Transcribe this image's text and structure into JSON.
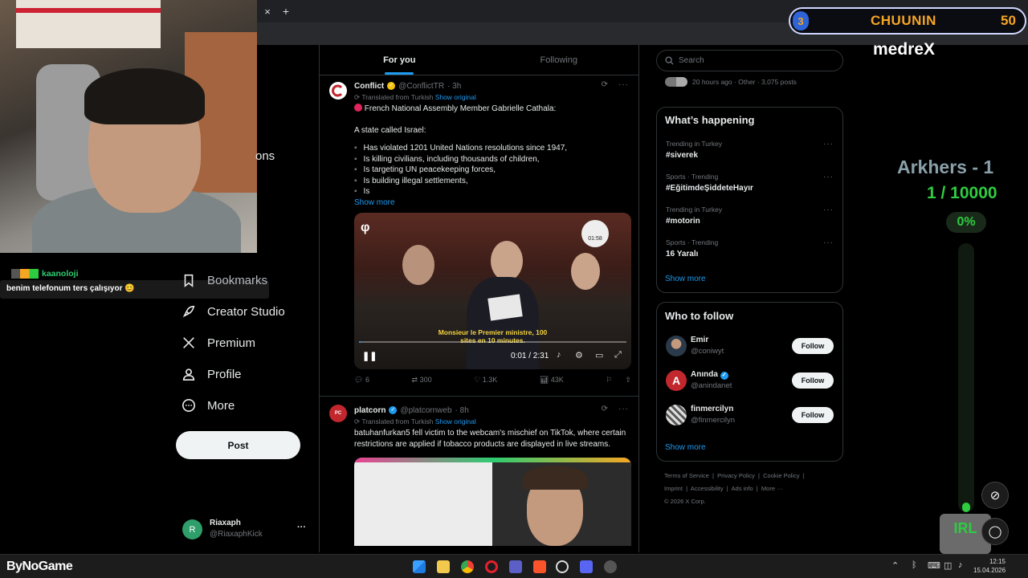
{
  "browser": {
    "close_tab": "×",
    "new_tab": "+"
  },
  "chat": {
    "username": "kaanoloji",
    "message": "benim telefonum ters çalışıyor 😊"
  },
  "left_nav": {
    "partial_item": "ons",
    "items": [
      {
        "label": "Bookmarks",
        "icon": "bookmark-icon"
      },
      {
        "label": "Creator Studio",
        "icon": "rocket-icon"
      },
      {
        "label": "Premium",
        "icon": "x-logo-icon"
      },
      {
        "label": "Profile",
        "icon": "person-icon"
      },
      {
        "label": "More",
        "icon": "more-circle-icon"
      }
    ],
    "post_label": "Post",
    "account": {
      "initial": "R",
      "name": "Riaxaph",
      "handle": "@RiaxaphKick",
      "menu": "···"
    }
  },
  "feed": {
    "tabs": [
      {
        "label": "For you",
        "active": true
      },
      {
        "label": "Following",
        "active": false
      }
    ],
    "tweets": [
      {
        "name": "Conflict",
        "handle": "@ConflictTR",
        "time": "· 3h",
        "translated": "Translated from Turkish",
        "show_original": "Show original",
        "line1": "French National Assembly Member Gabrielle Cathala:",
        "line2": "A state called Israel:",
        "bullets": [
          "Has violated 1201 United Nations resolutions since 1947,",
          "Is killing civilians, including thousands of children,",
          "Is targeting UN peacekeeping forces,",
          "Is building illegal settlements,",
          "Is"
        ],
        "show_more": "Show more",
        "video": {
          "subtitle1": "Monsieur le Premier ministre, 100",
          "subtitle2": "sites en 10 minutes.",
          "time": "0:01 / 2:31",
          "badge_time": "01:58",
          "progress": 0.007
        },
        "stats": {
          "replies": "6",
          "reposts": "300",
          "likes": "1.3K",
          "views": "43K"
        }
      },
      {
        "name": "platcorn",
        "handle": "@platcornweb",
        "time": "· 8h",
        "translated": "Translated from Turkish",
        "show_original": "Show original",
        "text": "batuhanfurkan5 fell victim to the webcam's mischief on TikTok, where certain restrictions are applied if tobacco products are displayed in live streams."
      }
    ]
  },
  "sidebar": {
    "search_placeholder": "Search",
    "top_meta": "20 hours ago · Other · 3,075 posts",
    "happening": {
      "title": "What’s happening",
      "trends": [
        {
          "meta": "Trending in Turkey",
          "name": "#siverek"
        },
        {
          "meta": "Sports · Trending",
          "name": "#EğitimdeŞiddeteHayır"
        },
        {
          "meta": "Trending in Turkey",
          "name": "#motorin"
        },
        {
          "meta": "Sports · Trending",
          "name": "16 Yaralı"
        }
      ],
      "show_more": "Show more"
    },
    "who_to_follow": {
      "title": "Who to follow",
      "accounts": [
        {
          "name": "Emir",
          "handle": "@coniwyt",
          "verified": false
        },
        {
          "name": "Anında",
          "handle": "@anindanet",
          "verified": true
        },
        {
          "name": "finmercilyn",
          "handle": "@finmercilyn",
          "verified": false
        }
      ],
      "follow_label": "Follow",
      "show_more": "Show more"
    },
    "footer": {
      "row1": [
        "Terms of Service",
        "Privacy Policy",
        "Cookie Policy"
      ],
      "row2": [
        "Imprint",
        "Accessibility",
        "Ads info",
        "More ···"
      ],
      "copyright": "© 2026 X Corp."
    }
  },
  "stream_overlay": {
    "rank_number": "3",
    "rank_name": "CHUUNIN",
    "rank_points": "50",
    "streamer": "medreX",
    "goal_title": "Arkhers - 1",
    "goal_progress": "1 / 10000",
    "goal_percent": "0%",
    "irl_label": "IRL",
    "colors": {
      "accent_orange": "#f5a623",
      "accent_green": "#2ecc40"
    }
  },
  "taskbar": {
    "brand": "ByNoGame",
    "clock_time": "12:15",
    "clock_date": "15.04.2026"
  }
}
